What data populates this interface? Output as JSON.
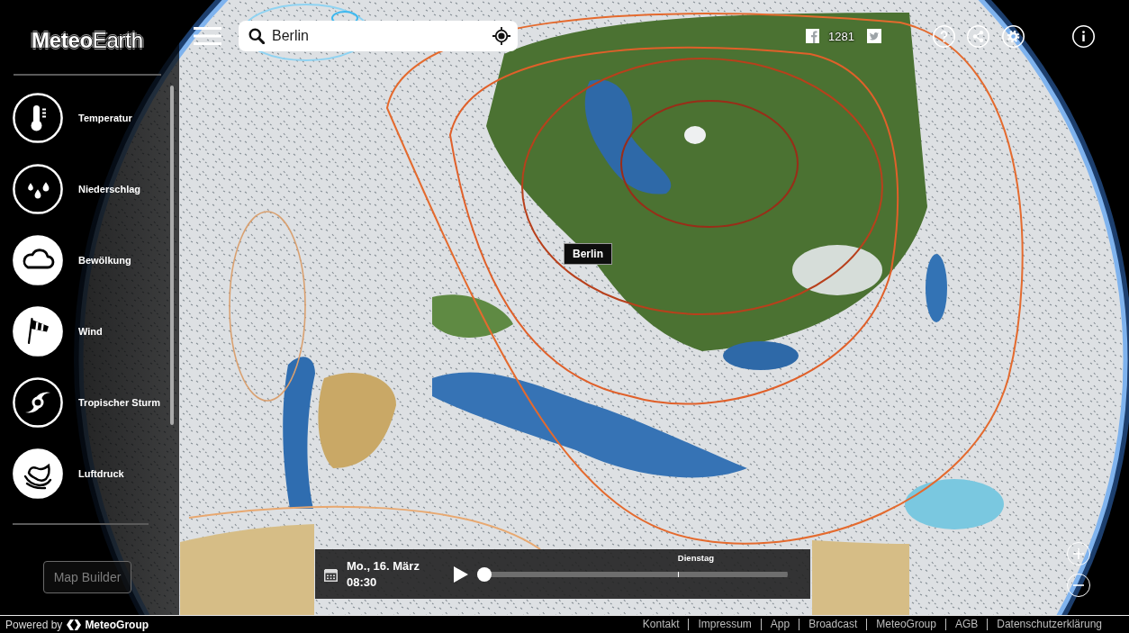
{
  "sidebar": {
    "logo": "**Meteo**Earth",
    "layers": [
      {
        "label": "Temperatur",
        "on": false
      },
      {
        "label": "Niederschlag",
        "on": false
      },
      {
        "label": "Bewölkung",
        "on": true
      },
      {
        "label": "Wind",
        "on": true
      },
      {
        "label": "Tropischer Sturm",
        "on": false
      },
      {
        "label": "Luftdruck",
        "on": true
      }
    ],
    "map_builder": {
      "label": "Map Builder",
      "disabled": true
    }
  },
  "search": {
    "value": "Berlin"
  },
  "share": {
    "facebook_count": "1281"
  },
  "map": {
    "location_label": "Berlin"
  },
  "timeline": {
    "date": "Mo., 16. März",
    "time": "08:30",
    "level": 0,
    "day_markers": [
      "Dienstag"
    ]
  },
  "footer": {
    "powered_by": "Powered by",
    "brand": "MeteoGroup",
    "links": [
      "Kontakt",
      "Impressum",
      "App",
      "Broadcast",
      "MeteoGroup",
      "AGB",
      "Datenschutzerklärung"
    ]
  }
}
